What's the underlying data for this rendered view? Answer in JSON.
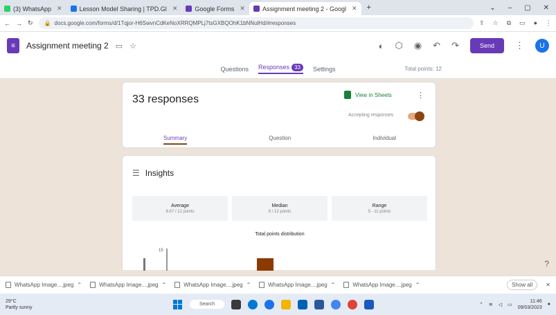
{
  "browser": {
    "tabs": [
      {
        "label": "(3) WhatsApp",
        "color": "#25d366"
      },
      {
        "label": "Lesson Model Sharing | TPD.Gl",
        "color": "#1a73e8"
      },
      {
        "label": "Google Forms",
        "color": "#673ab7"
      },
      {
        "label": "Assignment meeting 2 - Googl",
        "color": "#673ab7",
        "active": true
      }
    ],
    "url": "docs.google.com/forms/d/1Tqjor-H6SwvnCdKeNoXRRQMPLj7tsGXBQOhK1bNNulHd/#responses"
  },
  "form": {
    "title": "Assignment meeting 2",
    "send_label": "Send",
    "avatar_letter": "U",
    "tabs": [
      {
        "label": "Questions"
      },
      {
        "label": "Responses",
        "badge": "33",
        "active": true
      },
      {
        "label": "Settings"
      }
    ],
    "total_points": "Total points: 12"
  },
  "responses": {
    "title": "33 responses",
    "sheets_label": "View in Sheets",
    "accepting_label": "Accepting responses",
    "subtabs": [
      "Summary",
      "Question",
      "Individual"
    ]
  },
  "insights": {
    "title": "Insights",
    "stats": [
      {
        "label": "Average",
        "value": "8.67 / 12 points"
      },
      {
        "label": "Median",
        "value": "9 / 12 points"
      },
      {
        "label": "Range",
        "value": "5 - 11 points"
      }
    ],
    "distribution_title": "Total points distribution",
    "y_tick": "15"
  },
  "downloads": {
    "items": [
      "WhatsApp Image....jpeg",
      "WhatsApp Image....jpeg",
      "WhatsApp Image....jpeg",
      "WhatsApp Image....jpeg",
      "WhatsApp Image....jpeg"
    ],
    "show_all": "Show all"
  },
  "taskbar": {
    "weather_temp": "29°C",
    "weather_desc": "Partly sunny",
    "search_label": "Search",
    "time": "11:46",
    "date": "09/03/2023"
  }
}
